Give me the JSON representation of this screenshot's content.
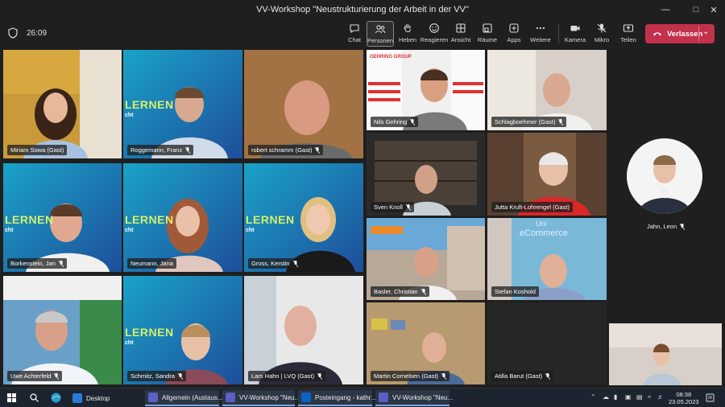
{
  "window": {
    "title": "VV-Workshop \"Neustrukturierung der Arbeit in der VV\""
  },
  "toolbar": {
    "timer": "26:09",
    "buttons": [
      {
        "label": "Chat",
        "icon": "chat-icon"
      },
      {
        "label": "Personen",
        "icon": "people-icon"
      },
      {
        "label": "Heben",
        "icon": "hand-icon"
      },
      {
        "label": "Reagieren",
        "icon": "smiley-icon"
      },
      {
        "label": "Ansicht",
        "icon": "view-icon"
      },
      {
        "label": "Räume",
        "icon": "rooms-icon"
      },
      {
        "label": "Apps",
        "icon": "apps-icon"
      },
      {
        "label": "Weitere",
        "icon": "more-icon"
      },
      {
        "label": "Kamera",
        "icon": "camera-icon"
      },
      {
        "label": "Mikro",
        "icon": "mic-off-icon"
      },
      {
        "label": "Teilen",
        "icon": "share-icon"
      }
    ],
    "leave_label": "Verlassen"
  },
  "participants": {
    "miriam": "Miriam Sowa (Gast)",
    "roggemann": "Roggemann, Franz",
    "schramm": "robert schramm (Gast)",
    "gehring": "Nils Gehring",
    "schlagboehmer": "Schlagboehmer (Gast)",
    "knoll": "Sven Knoll",
    "kruft": "Jutta Kruft-Lohrengel (Gast)",
    "borkenstein": "Borkenstein, Jan",
    "neumann": "Neumann, Jana",
    "gross": "Gross, Kerstin",
    "basler": "Basler, Christian",
    "koshold": "Stefan Koshold",
    "achterfeld": "Uwe Achterfeld",
    "schmitz": "Schmitz, Sandra",
    "hahn": "Lars Hahn | LVQ (Gast)",
    "cornelsen": "Martin Cornelsen (Gast)",
    "barut": "Atilla Barut (Gast)",
    "jahn": "Jahn, Leon"
  },
  "backgrounds": {
    "lernen": "LERNEN",
    "cht": "cht",
    "ecommerce": "eCommerce",
    "uni": "Uni",
    "gehring_logo": "GEHRING GROUP"
  },
  "taskbar": {
    "items": [
      {
        "label": "Desktop"
      },
      {
        "label": "Allgemein (Austaus..."
      },
      {
        "label": "VV-Workshop \"Neu..."
      },
      {
        "label": "Posteingang - kathr..."
      },
      {
        "label": "VV-Workshop \"Neu..."
      }
    ],
    "time": "08:38",
    "date": "23.05.2023"
  },
  "colors": {
    "accent": "#7f85f5",
    "leave": "#c4314b",
    "lernen_green": "#d6f06a"
  }
}
